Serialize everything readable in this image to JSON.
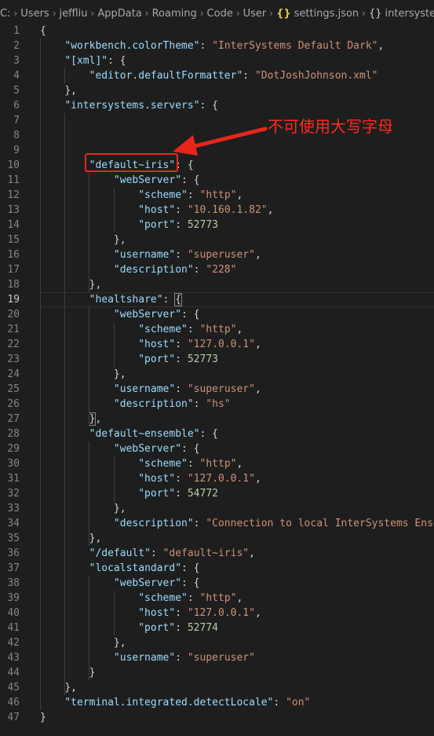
{
  "breadcrumb": {
    "segments": [
      "C:",
      "Users",
      "jeffliu",
      "AppData",
      "Roaming",
      "Code",
      "User"
    ],
    "file_icon": "{}",
    "file": "settings.json",
    "symbol_icon": "{}",
    "symbol": "intersystems.s"
  },
  "annotation": {
    "text": "不可使用大写字母",
    "color": "#ff2a1e"
  },
  "colors": {
    "key": "#9cdcfe",
    "string": "#ce9178",
    "number": "#b5cea8",
    "punct": "#d4d4d4",
    "annotation_red": "#e8261c"
  },
  "lines": [
    {
      "n": "1",
      "t": [
        [
          "p",
          "{"
        ]
      ]
    },
    {
      "n": "2",
      "t": [
        [
          "i",
          "    "
        ],
        [
          "k",
          "\"workbench.colorTheme\""
        ],
        [
          "p",
          ": "
        ],
        [
          "s",
          "\"InterSystems Default Dark\""
        ],
        [
          "p",
          ","
        ]
      ]
    },
    {
      "n": "3",
      "t": [
        [
          "i",
          "    "
        ],
        [
          "k",
          "\"[xml]\""
        ],
        [
          "p",
          ": {"
        ]
      ]
    },
    {
      "n": "4",
      "t": [
        [
          "i",
          "        "
        ],
        [
          "k",
          "\"editor.defaultFormatter\""
        ],
        [
          "p",
          ": "
        ],
        [
          "s",
          "\"DotJoshJohnson.xml\""
        ]
      ]
    },
    {
      "n": "5",
      "t": [
        [
          "i",
          "    "
        ],
        [
          "p",
          "},"
        ]
      ]
    },
    {
      "n": "6",
      "t": [
        [
          "i",
          "    "
        ],
        [
          "k",
          "\"intersystems.servers\""
        ],
        [
          "p",
          ": {"
        ]
      ]
    },
    {
      "n": "7",
      "t": []
    },
    {
      "n": "8",
      "t": []
    },
    {
      "n": "9",
      "t": []
    },
    {
      "n": "10",
      "t": [
        [
          "i",
          "        "
        ],
        [
          "k",
          "\"default~iris\""
        ],
        [
          "p",
          ": {"
        ]
      ]
    },
    {
      "n": "11",
      "t": [
        [
          "i",
          "            "
        ],
        [
          "k",
          "\"webServer\""
        ],
        [
          "p",
          ": {"
        ]
      ]
    },
    {
      "n": "12",
      "t": [
        [
          "i",
          "                "
        ],
        [
          "k",
          "\"scheme\""
        ],
        [
          "p",
          ": "
        ],
        [
          "s",
          "\"http\""
        ],
        [
          "p",
          ","
        ]
      ]
    },
    {
      "n": "13",
      "t": [
        [
          "i",
          "                "
        ],
        [
          "k",
          "\"host\""
        ],
        [
          "p",
          ": "
        ],
        [
          "s",
          "\"10.160.1.82\""
        ],
        [
          "p",
          ","
        ]
      ]
    },
    {
      "n": "14",
      "t": [
        [
          "i",
          "                "
        ],
        [
          "k",
          "\"port\""
        ],
        [
          "p",
          ": "
        ],
        [
          "n",
          "52773"
        ]
      ]
    },
    {
      "n": "15",
      "t": [
        [
          "i",
          "            "
        ],
        [
          "p",
          "},"
        ]
      ]
    },
    {
      "n": "16",
      "t": [
        [
          "i",
          "            "
        ],
        [
          "k",
          "\"username\""
        ],
        [
          "p",
          ": "
        ],
        [
          "s",
          "\"superuser\""
        ],
        [
          "p",
          ","
        ]
      ]
    },
    {
      "n": "17",
      "t": [
        [
          "i",
          "            "
        ],
        [
          "k",
          "\"description\""
        ],
        [
          "p",
          ": "
        ],
        [
          "s",
          "\"228\""
        ]
      ]
    },
    {
      "n": "18",
      "t": [
        [
          "i",
          "        "
        ],
        [
          "p",
          "},"
        ]
      ]
    },
    {
      "n": "19",
      "t": [
        [
          "i",
          "        "
        ],
        [
          "k",
          "\"healtshare\""
        ],
        [
          "p",
          ": "
        ],
        [
          "b",
          "{"
        ]
      ]
    },
    {
      "n": "20",
      "t": [
        [
          "i",
          "            "
        ],
        [
          "k",
          "\"webServer\""
        ],
        [
          "p",
          ": {"
        ]
      ]
    },
    {
      "n": "21",
      "t": [
        [
          "i",
          "                "
        ],
        [
          "k",
          "\"scheme\""
        ],
        [
          "p",
          ": "
        ],
        [
          "s",
          "\"http\""
        ],
        [
          "p",
          ","
        ]
      ]
    },
    {
      "n": "22",
      "t": [
        [
          "i",
          "                "
        ],
        [
          "k",
          "\"host\""
        ],
        [
          "p",
          ": "
        ],
        [
          "s",
          "\"127.0.0.1\""
        ],
        [
          "p",
          ","
        ]
      ]
    },
    {
      "n": "23",
      "t": [
        [
          "i",
          "                "
        ],
        [
          "k",
          "\"port\""
        ],
        [
          "p",
          ": "
        ],
        [
          "n",
          "52773"
        ]
      ]
    },
    {
      "n": "24",
      "t": [
        [
          "i",
          "            "
        ],
        [
          "p",
          "},"
        ]
      ]
    },
    {
      "n": "25",
      "t": [
        [
          "i",
          "            "
        ],
        [
          "k",
          "\"username\""
        ],
        [
          "p",
          ": "
        ],
        [
          "s",
          "\"superuser\""
        ],
        [
          "p",
          ","
        ]
      ]
    },
    {
      "n": "26",
      "t": [
        [
          "i",
          "            "
        ],
        [
          "k",
          "\"description\""
        ],
        [
          "p",
          ": "
        ],
        [
          "s",
          "\"hs\""
        ]
      ]
    },
    {
      "n": "27",
      "t": [
        [
          "i",
          "        "
        ],
        [
          "b",
          "}"
        ],
        [
          "p",
          ","
        ]
      ]
    },
    {
      "n": "28",
      "t": [
        [
          "i",
          "        "
        ],
        [
          "k",
          "\"default~ensemble\""
        ],
        [
          "p",
          ": {"
        ]
      ]
    },
    {
      "n": "29",
      "t": [
        [
          "i",
          "            "
        ],
        [
          "k",
          "\"webServer\""
        ],
        [
          "p",
          ": {"
        ]
      ]
    },
    {
      "n": "30",
      "t": [
        [
          "i",
          "                "
        ],
        [
          "k",
          "\"scheme\""
        ],
        [
          "p",
          ": "
        ],
        [
          "s",
          "\"http\""
        ],
        [
          "p",
          ","
        ]
      ]
    },
    {
      "n": "31",
      "t": [
        [
          "i",
          "                "
        ],
        [
          "k",
          "\"host\""
        ],
        [
          "p",
          ": "
        ],
        [
          "s",
          "\"127.0.0.1\""
        ],
        [
          "p",
          ","
        ]
      ]
    },
    {
      "n": "32",
      "t": [
        [
          "i",
          "                "
        ],
        [
          "k",
          "\"port\""
        ],
        [
          "p",
          ": "
        ],
        [
          "n",
          "54772"
        ]
      ]
    },
    {
      "n": "33",
      "t": [
        [
          "i",
          "            "
        ],
        [
          "p",
          "},"
        ]
      ]
    },
    {
      "n": "34",
      "t": [
        [
          "i",
          "            "
        ],
        [
          "k",
          "\"description\""
        ],
        [
          "p",
          ": "
        ],
        [
          "s",
          "\"Connection to local InterSystems Ensemb"
        ]
      ]
    },
    {
      "n": "35",
      "t": [
        [
          "i",
          "        "
        ],
        [
          "p",
          "},"
        ]
      ]
    },
    {
      "n": "36",
      "t": [
        [
          "i",
          "        "
        ],
        [
          "k",
          "\"/default\""
        ],
        [
          "p",
          ": "
        ],
        [
          "s",
          "\"default~iris\""
        ],
        [
          "p",
          ","
        ]
      ]
    },
    {
      "n": "37",
      "t": [
        [
          "i",
          "        "
        ],
        [
          "k",
          "\"localstandard\""
        ],
        [
          "p",
          ": {"
        ]
      ]
    },
    {
      "n": "38",
      "t": [
        [
          "i",
          "            "
        ],
        [
          "k",
          "\"webServer\""
        ],
        [
          "p",
          ": {"
        ]
      ]
    },
    {
      "n": "39",
      "t": [
        [
          "i",
          "                "
        ],
        [
          "k",
          "\"scheme\""
        ],
        [
          "p",
          ": "
        ],
        [
          "s",
          "\"http\""
        ],
        [
          "p",
          ","
        ]
      ]
    },
    {
      "n": "40",
      "t": [
        [
          "i",
          "                "
        ],
        [
          "k",
          "\"host\""
        ],
        [
          "p",
          ": "
        ],
        [
          "s",
          "\"127.0.0.1\""
        ],
        [
          "p",
          ","
        ]
      ]
    },
    {
      "n": "41",
      "t": [
        [
          "i",
          "                "
        ],
        [
          "k",
          "\"port\""
        ],
        [
          "p",
          ": "
        ],
        [
          "n",
          "52774"
        ]
      ]
    },
    {
      "n": "42",
      "t": [
        [
          "i",
          "            "
        ],
        [
          "p",
          "},"
        ]
      ]
    },
    {
      "n": "43",
      "t": [
        [
          "i",
          "            "
        ],
        [
          "k",
          "\"username\""
        ],
        [
          "p",
          ": "
        ],
        [
          "s",
          "\"superuser\""
        ]
      ]
    },
    {
      "n": "44",
      "t": [
        [
          "i",
          "        "
        ],
        [
          "p",
          "}"
        ]
      ]
    },
    {
      "n": "45",
      "t": [
        [
          "i",
          "    "
        ],
        [
          "p",
          "},"
        ]
      ]
    },
    {
      "n": "46",
      "t": [
        [
          "i",
          "    "
        ],
        [
          "k",
          "\"terminal.integrated.detectLocale\""
        ],
        [
          "p",
          ": "
        ],
        [
          "s",
          "\"on\""
        ]
      ]
    },
    {
      "n": "47",
      "t": [
        [
          "p",
          "}"
        ]
      ]
    }
  ],
  "active_line": "19"
}
